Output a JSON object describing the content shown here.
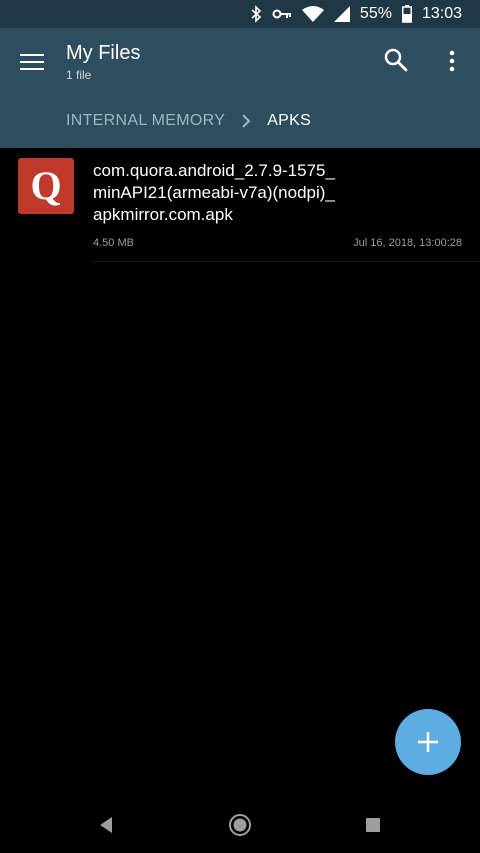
{
  "status_bar": {
    "battery_percent": "55%",
    "time": "13:03",
    "icons": [
      "bluetooth-icon",
      "vpn-key-icon",
      "wifi-icon",
      "signal-icon",
      "battery-icon"
    ]
  },
  "app_bar": {
    "title": "My Files",
    "subtitle": "1 file",
    "icons": [
      "menu-icon",
      "search-icon",
      "more-vert-icon"
    ]
  },
  "breadcrumb": {
    "root": "INTERNAL MEMORY",
    "separator_icon": "chevron-right-icon",
    "current": "APKS"
  },
  "files": [
    {
      "icon_letter": "Q",
      "name": "com.quora.android_2.7.9-1575_minAPI21(armeabi-v7a)(nodpi)_apkmirror.com.apk",
      "size": "4.50 MB",
      "date": "Jul 16, 2018, 13:00:28"
    }
  ],
  "fab": {
    "icon": "add-icon"
  },
  "nav_bar": {
    "icons": [
      "back-icon",
      "home-icon",
      "recents-icon"
    ]
  },
  "colors": {
    "status_bar": "#203846",
    "app_bar": "#2e4d5e",
    "fab": "#5dade2",
    "file_icon": "#c0392b",
    "background": "#000000"
  }
}
